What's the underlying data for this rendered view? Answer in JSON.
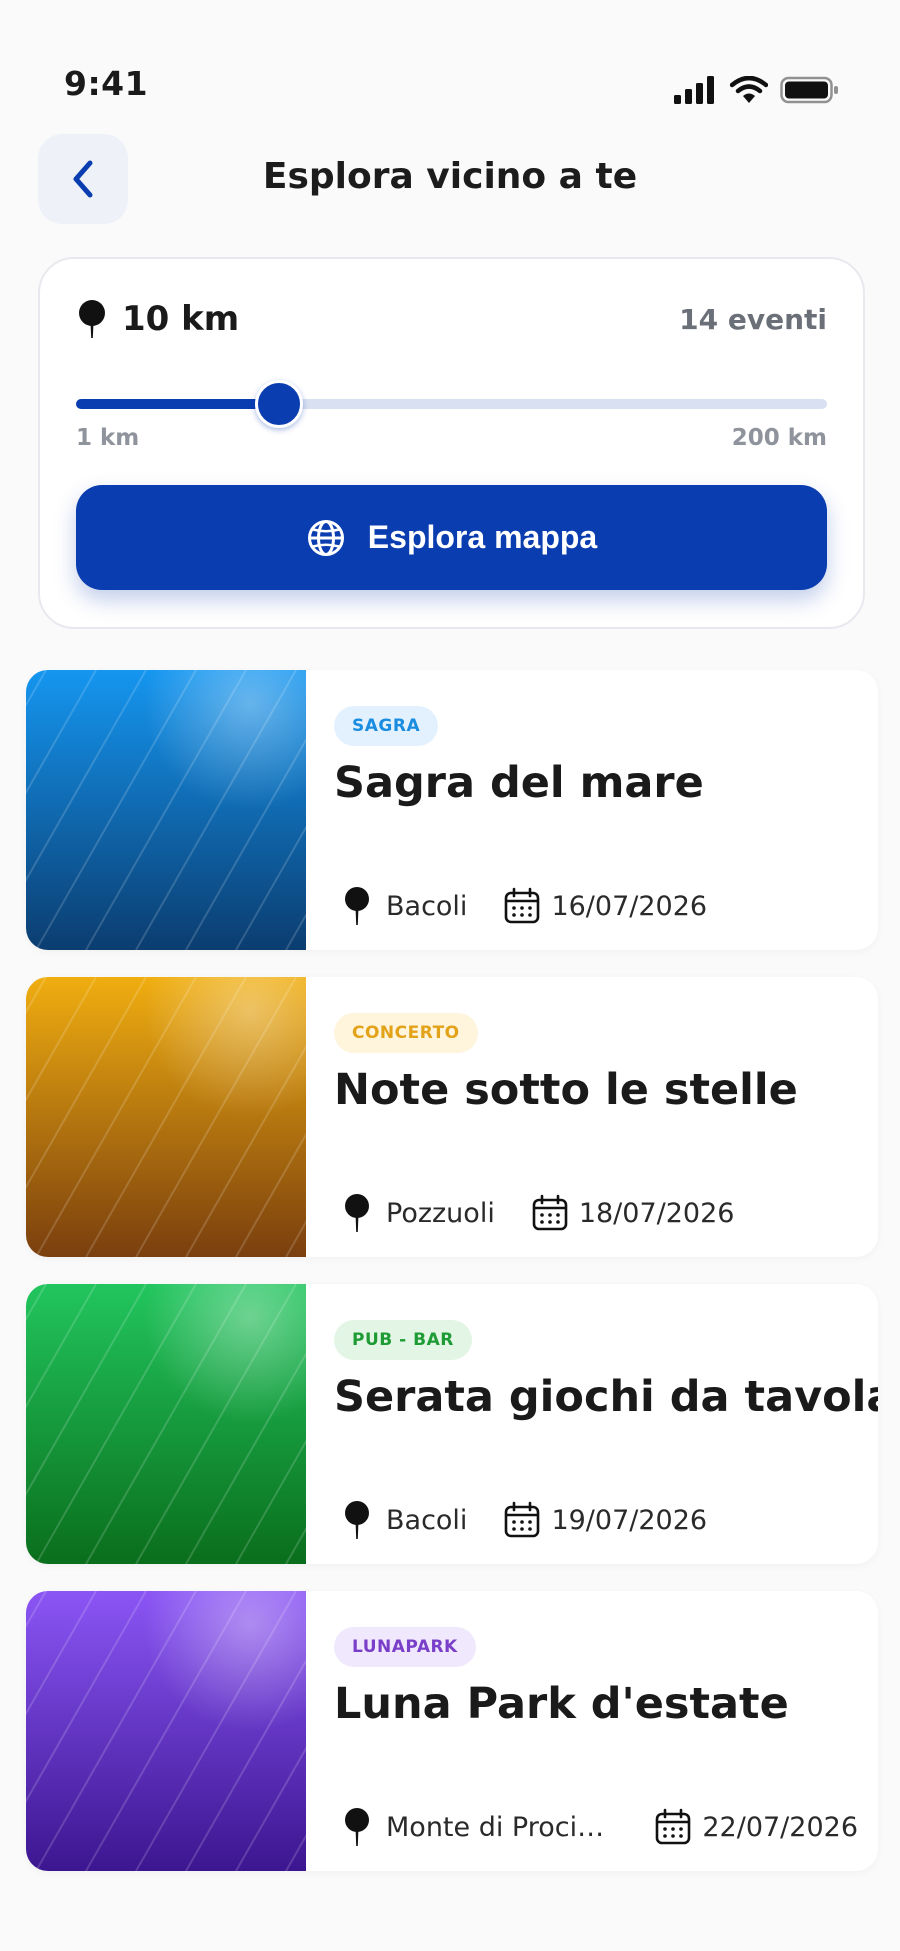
{
  "status_bar": {
    "time": "9:41"
  },
  "header": {
    "title": "Esplora vicino a te"
  },
  "radius": {
    "value_label": "10 km",
    "event_count": "14 eventi",
    "min_label": "1 km",
    "max_label": "200 km",
    "slider_fraction": 0.27
  },
  "map_button": {
    "label": "Esplora mappa"
  },
  "colors": {
    "primary": "#0a3db0",
    "track": "#d8e0f1"
  },
  "events": [
    {
      "category": "SAGRA",
      "title": "Sagra del mare",
      "location": "Bacoli",
      "date": "16/07/2026",
      "badge_bg": "#e3f1ff",
      "badge_fg": "#1a8de0",
      "thumb_from": "#1596f0",
      "thumb_to": "#0b3d70"
    },
    {
      "category": "CONCERTO",
      "title": "Note sotto le stelle",
      "location": "Pozzuoli",
      "date": "18/07/2026",
      "badge_bg": "#fff4dc",
      "badge_fg": "#e3a318",
      "thumb_from": "#f0ae10",
      "thumb_to": "#7a3f0e"
    },
    {
      "category": "PUB - BAR",
      "title": "Serata giochi da tavola",
      "location": "Bacoli",
      "date": "19/07/2026",
      "badge_bg": "#e3f6e6",
      "badge_fg": "#1e9b35",
      "thumb_from": "#22c55e",
      "thumb_to": "#0a6e1c"
    },
    {
      "category": "LUNAPARK",
      "title": "Luna Park d'estate",
      "location": "Monte di Proci…",
      "date": "22/07/2026",
      "badge_bg": "#f0e8fc",
      "badge_fg": "#7a3fc9",
      "thumb_from": "#8b55f5",
      "thumb_to": "#3c1690"
    }
  ]
}
